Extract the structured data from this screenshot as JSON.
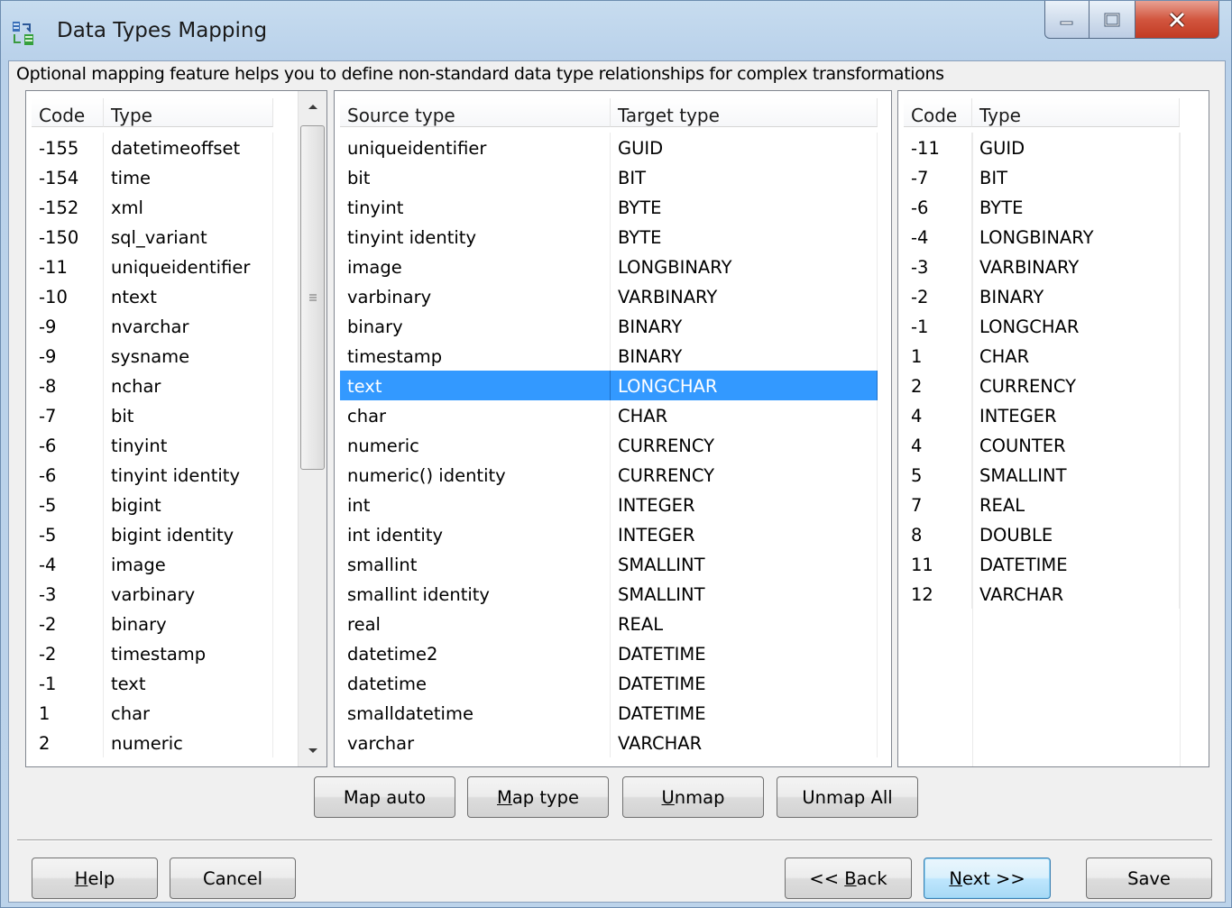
{
  "window": {
    "title": "Data Types Mapping"
  },
  "description": "Optional mapping feature helps you to define non-standard data type relationships for complex transformations",
  "source_table": {
    "headers": {
      "code": "Code",
      "type": "Type"
    },
    "rows": [
      {
        "code": "-155",
        "type": "datetimeoffset"
      },
      {
        "code": "-154",
        "type": "time"
      },
      {
        "code": "-152",
        "type": "xml"
      },
      {
        "code": "-150",
        "type": "sql_variant"
      },
      {
        "code": "-11",
        "type": "uniqueidentifier"
      },
      {
        "code": "-10",
        "type": "ntext"
      },
      {
        "code": "-9",
        "type": "nvarchar"
      },
      {
        "code": "-9",
        "type": "sysname"
      },
      {
        "code": "-8",
        "type": "nchar"
      },
      {
        "code": "-7",
        "type": "bit"
      },
      {
        "code": "-6",
        "type": "tinyint"
      },
      {
        "code": "-6",
        "type": "tinyint identity"
      },
      {
        "code": "-5",
        "type": "bigint"
      },
      {
        "code": "-5",
        "type": "bigint identity"
      },
      {
        "code": "-4",
        "type": "image"
      },
      {
        "code": "-3",
        "type": "varbinary"
      },
      {
        "code": "-2",
        "type": "binary"
      },
      {
        "code": "-2",
        "type": "timestamp"
      },
      {
        "code": "-1",
        "type": "text"
      },
      {
        "code": "1",
        "type": "char"
      },
      {
        "code": "2",
        "type": "numeric"
      }
    ]
  },
  "mapping_table": {
    "headers": {
      "source": "Source type",
      "target": "Target type"
    },
    "selected_index": 8,
    "rows": [
      {
        "source": "uniqueidentifier",
        "target": "GUID"
      },
      {
        "source": "bit",
        "target": "BIT"
      },
      {
        "source": "tinyint",
        "target": "BYTE"
      },
      {
        "source": "tinyint identity",
        "target": "BYTE"
      },
      {
        "source": "image",
        "target": "LONGBINARY"
      },
      {
        "source": "varbinary",
        "target": "VARBINARY"
      },
      {
        "source": "binary",
        "target": "BINARY"
      },
      {
        "source": "timestamp",
        "target": "BINARY"
      },
      {
        "source": "text",
        "target": "LONGCHAR"
      },
      {
        "source": "char",
        "target": "CHAR"
      },
      {
        "source": "numeric",
        "target": "CURRENCY"
      },
      {
        "source": "numeric() identity",
        "target": "CURRENCY"
      },
      {
        "source": "int",
        "target": "INTEGER"
      },
      {
        "source": "int identity",
        "target": "INTEGER"
      },
      {
        "source": "smallint",
        "target": "SMALLINT"
      },
      {
        "source": "smallint identity",
        "target": "SMALLINT"
      },
      {
        "source": "real",
        "target": "REAL"
      },
      {
        "source": "datetime2",
        "target": "DATETIME"
      },
      {
        "source": "datetime",
        "target": "DATETIME"
      },
      {
        "source": "smalldatetime",
        "target": "DATETIME"
      },
      {
        "source": "varchar",
        "target": "VARCHAR"
      }
    ]
  },
  "target_table": {
    "headers": {
      "code": "Code",
      "type": "Type"
    },
    "rows": [
      {
        "code": "-11",
        "type": "GUID"
      },
      {
        "code": "-7",
        "type": "BIT"
      },
      {
        "code": "-6",
        "type": "BYTE"
      },
      {
        "code": "-4",
        "type": "LONGBINARY"
      },
      {
        "code": "-3",
        "type": "VARBINARY"
      },
      {
        "code": "-2",
        "type": "BINARY"
      },
      {
        "code": "-1",
        "type": "LONGCHAR"
      },
      {
        "code": "1",
        "type": "CHAR"
      },
      {
        "code": "2",
        "type": "CURRENCY"
      },
      {
        "code": "4",
        "type": "INTEGER"
      },
      {
        "code": "4",
        "type": "COUNTER"
      },
      {
        "code": "5",
        "type": "SMALLINT"
      },
      {
        "code": "7",
        "type": "REAL"
      },
      {
        "code": "8",
        "type": "DOUBLE"
      },
      {
        "code": "11",
        "type": "DATETIME"
      },
      {
        "code": "12",
        "type": "VARCHAR"
      }
    ]
  },
  "actions": {
    "map_auto": "Map auto",
    "map_type": {
      "u": "M",
      "rest": "ap type"
    },
    "unmap": {
      "u": "U",
      "rest": "nmap"
    },
    "unmap_all": "Unmap All"
  },
  "footer": {
    "help": {
      "u": "H",
      "rest": "elp"
    },
    "cancel": "Cancel",
    "back": {
      "pre": "<< ",
      "u": "B",
      "rest": "ack"
    },
    "next": {
      "u": "N",
      "rest": "ext >>"
    },
    "save": "Save"
  },
  "colors": {
    "selection": "#3399ff",
    "close_button": "#c94a33"
  },
  "icons": [
    "app-icon",
    "minimize-icon",
    "maximize-icon",
    "close-icon",
    "scroll-up-icon",
    "scroll-down-icon",
    "scroll-grip-icon"
  ]
}
